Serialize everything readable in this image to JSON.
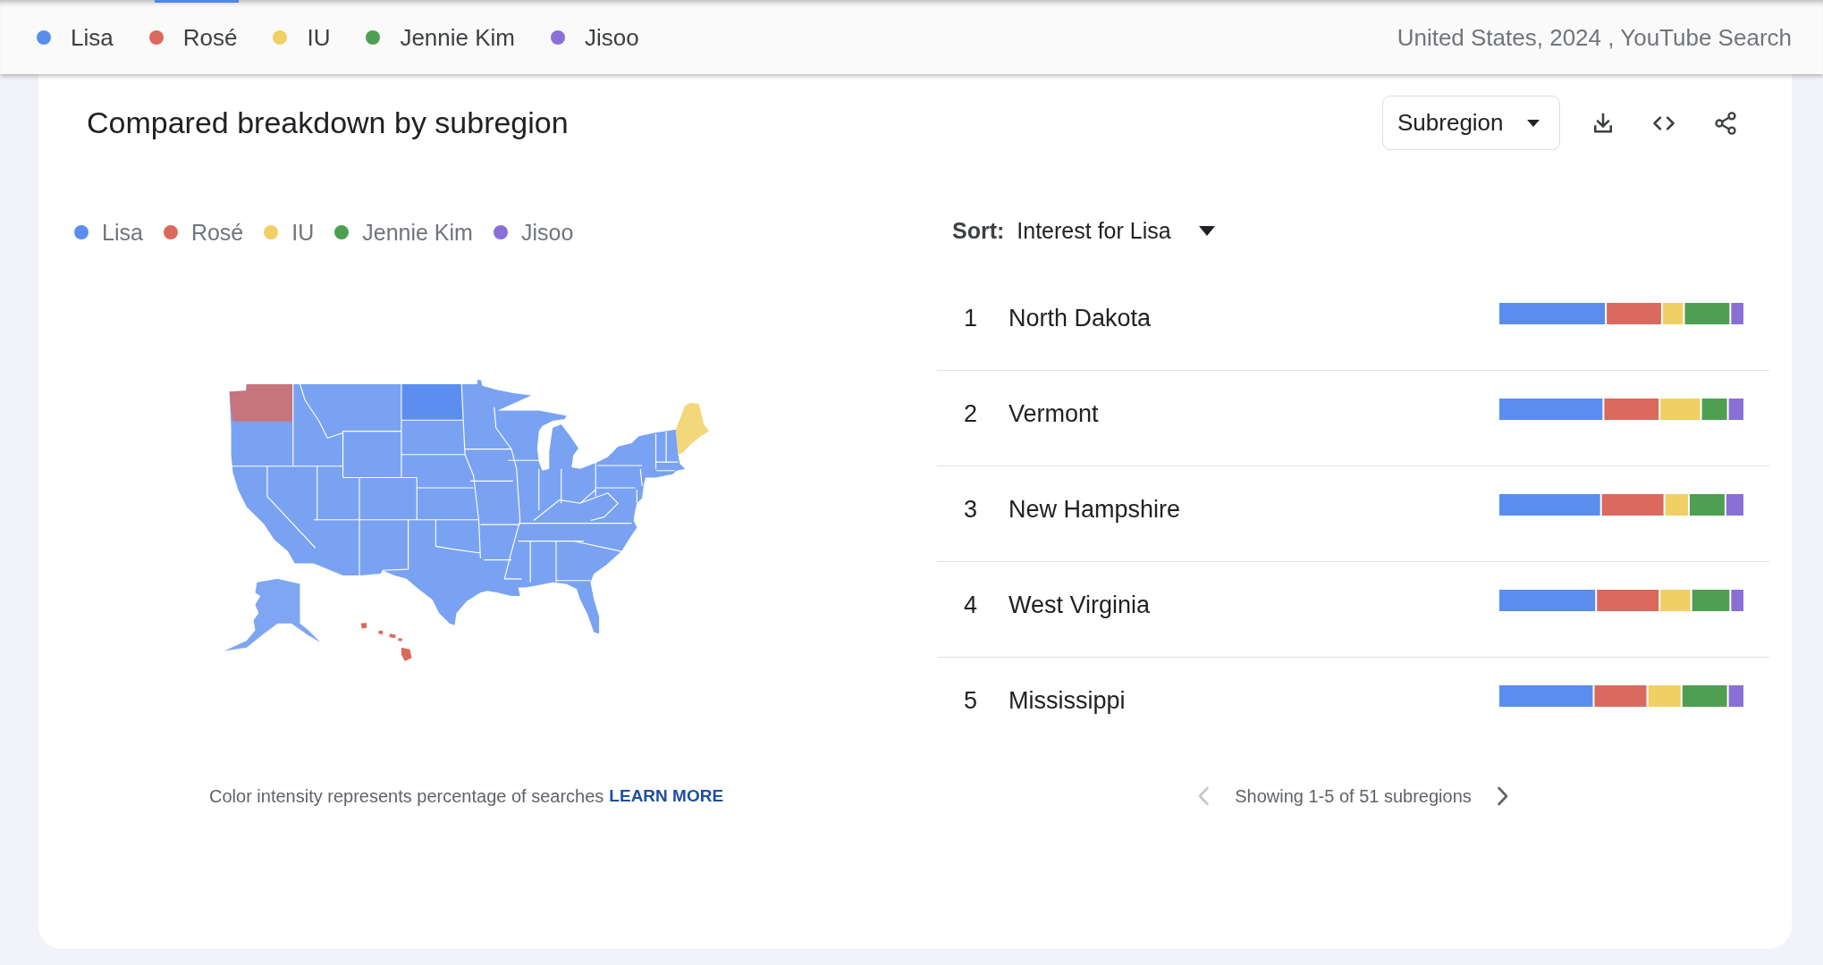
{
  "top_bar": {
    "legend": [
      {
        "label": "Lisa",
        "color": "#5b8def"
      },
      {
        "label": "Rosé",
        "color": "#da6a5e"
      },
      {
        "label": "IU",
        "color": "#f0d064"
      },
      {
        "label": "Jennie Kim",
        "color": "#4f9f52"
      },
      {
        "label": "Jisoo",
        "color": "#8a6fd6"
      }
    ],
    "context": "United States, 2024 , YouTube Search"
  },
  "card": {
    "title": "Compared breakdown by subregion",
    "view_dropdown": "Subregion",
    "legend": [
      {
        "label": "Lisa",
        "color": "#5b8def"
      },
      {
        "label": "Rosé",
        "color": "#da6a5e"
      },
      {
        "label": "IU",
        "color": "#f0d064"
      },
      {
        "label": "Jennie Kim",
        "color": "#4f9f52"
      },
      {
        "label": "Jisoo",
        "color": "#8a6fd6"
      }
    ],
    "map_note": {
      "text": "Color intensity represents percentage of searches",
      "link": "LEARN MORE"
    },
    "sort": {
      "label": "Sort:",
      "value": "Interest for Lisa"
    },
    "rows": [
      {
        "rank": "1",
        "name": "North Dakota"
      },
      {
        "rank": "2",
        "name": "Vermont"
      },
      {
        "rank": "3",
        "name": "New Hampshire"
      },
      {
        "rank": "4",
        "name": "West Virginia"
      },
      {
        "rank": "5",
        "name": "Mississippi"
      }
    ],
    "pagination": {
      "previous": {
        "disabled": true
      },
      "status": "Showing 1-5 of 51 subregions",
      "next": {
        "disabled": false
      }
    }
  }
}
